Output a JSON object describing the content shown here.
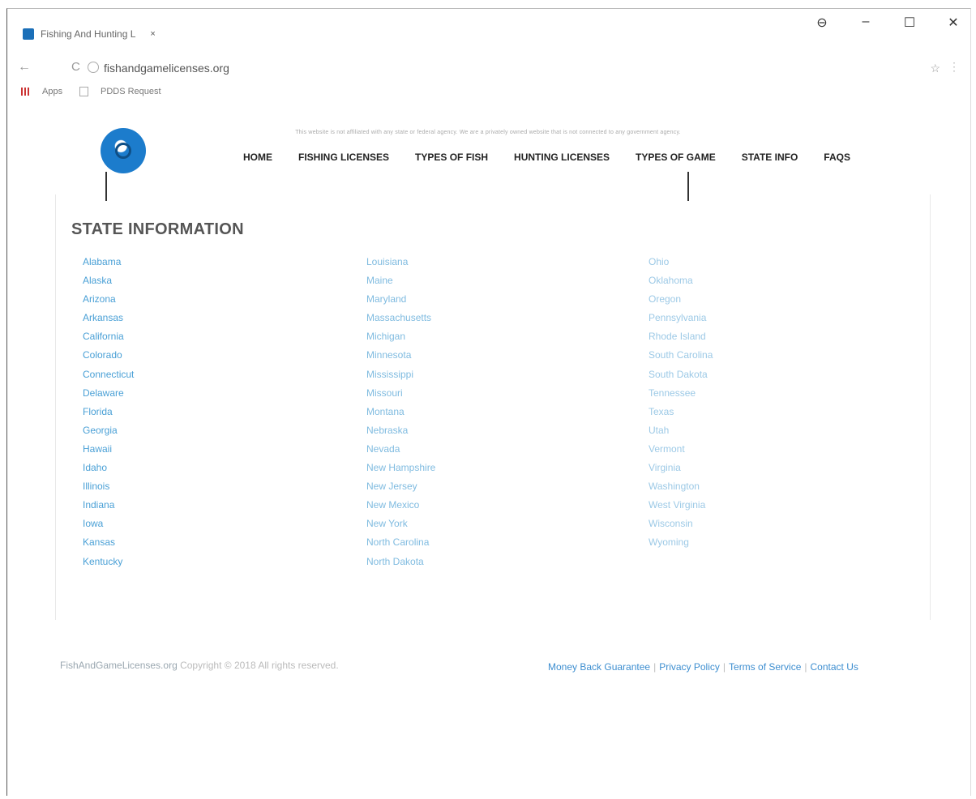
{
  "browser": {
    "tab_title": "Fishing And Hunting L",
    "tab_close": "×",
    "url": "fishandgamelicenses.org",
    "bookmarks": [
      "Apps",
      "PDDS Request"
    ],
    "controls": {
      "account": "⊖",
      "minimize": "–",
      "maximize": "☐",
      "close": "✕"
    },
    "nav": {
      "back": "←",
      "reload": "C",
      "star": "☆",
      "menu": "⋮"
    }
  },
  "site": {
    "notice": "This website is not affiliated with any state or federal agency. We are a privately owned website that is not connected to any government agency.",
    "nav_items": [
      "HOME",
      "FISHING LICENSES",
      "TYPES OF FISH",
      "HUNTING LICENSES",
      "TYPES OF GAME",
      "STATE INFO",
      "FAQS"
    ],
    "page_title": "STATE INFORMATION",
    "states": {
      "column_1": [
        "Alabama",
        "Alaska",
        "Arizona",
        "Arkansas",
        "California",
        "Colorado",
        "Connecticut",
        "Delaware",
        "Florida",
        "Georgia",
        "Hawaii",
        "Idaho",
        "Illinois",
        "Indiana",
        "Iowa",
        "Kansas",
        "Kentucky"
      ],
      "column_2": [
        "Louisiana",
        "Maine",
        "Maryland",
        "Massachusetts",
        "Michigan",
        "Minnesota",
        "Mississippi",
        "Missouri",
        "Montana",
        "Nebraska",
        "Nevada",
        "New Hampshire",
        "New Jersey",
        "New Mexico",
        "New York",
        "North Carolina",
        "North Dakota"
      ],
      "column_3": [
        "Ohio",
        "Oklahoma",
        "Oregon",
        "Pennsylvania",
        "Rhode Island",
        "South Carolina",
        "South Dakota",
        "Tennessee",
        "Texas",
        "Utah",
        "Vermont",
        "Virginia",
        "Washington",
        "West Virginia",
        "Wisconsin",
        "Wyoming"
      ]
    },
    "footer": {
      "brand": "FishAndGameLicenses.org",
      "copyright": " Copyright © 2018 All rights reserved.",
      "links": [
        "Money Back Guarantee",
        "Privacy Policy",
        "Terms of Service",
        "Contact Us"
      ],
      "separator": "|"
    },
    "colors": {
      "accent": "#1c7ccc",
      "link": "#4aa0d6"
    }
  }
}
